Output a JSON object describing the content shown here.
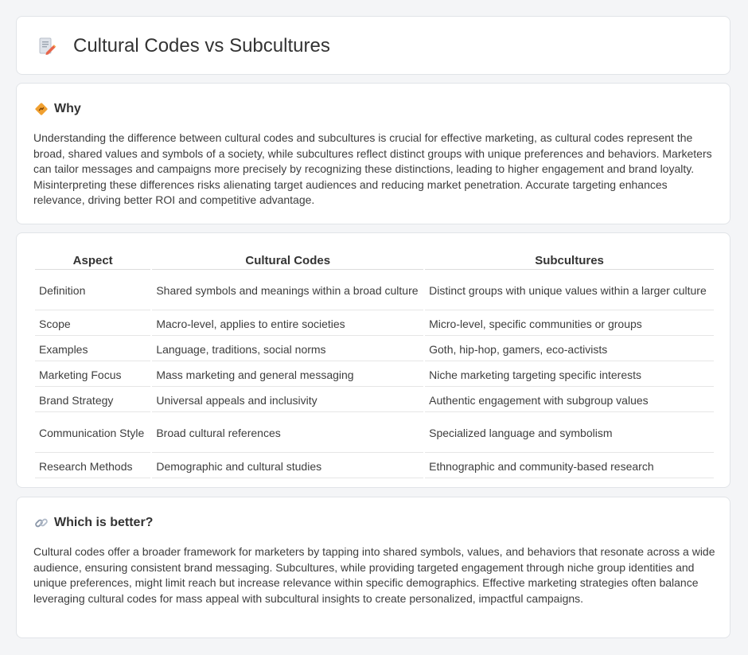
{
  "header": {
    "title": "Cultural Codes vs Subcultures",
    "icon": "document-pencil-icon"
  },
  "why": {
    "heading": "Why",
    "icon": "diamond-sign-icon",
    "body": "Understanding the difference between cultural codes and subcultures is crucial for effective marketing, as cultural codes represent the broad, shared values and symbols of a society, while subcultures reflect distinct groups with unique preferences and behaviors. Marketers can tailor messages and campaigns more precisely by recognizing these distinctions, leading to higher engagement and brand loyalty. Misinterpreting these differences risks alienating target audiences and reducing market penetration. Accurate targeting enhances relevance, driving better ROI and competitive advantage."
  },
  "table": {
    "headers": [
      "Aspect",
      "Cultural Codes",
      "Subcultures"
    ],
    "rows": [
      [
        "Definition",
        "Shared symbols and meanings within a broad culture",
        "Distinct groups with unique values within a larger culture"
      ],
      [
        "Scope",
        "Macro-level, applies to entire societies",
        "Micro-level, specific communities or groups"
      ],
      [
        "Examples",
        "Language, traditions, social norms",
        "Goth, hip-hop, gamers, eco-activists"
      ],
      [
        "Marketing Focus",
        "Mass marketing and general messaging",
        "Niche marketing targeting specific interests"
      ],
      [
        "Brand Strategy",
        "Universal appeals and inclusivity",
        "Authentic engagement with subgroup values"
      ],
      [
        "Communication Style",
        "Broad cultural references",
        "Specialized language and symbolism"
      ],
      [
        "Research Methods",
        "Demographic and cultural studies",
        "Ethnographic and community-based research"
      ]
    ]
  },
  "better": {
    "heading": "Which is better?",
    "icon": "link-icon",
    "body": "Cultural codes offer a broader framework for marketers by tapping into shared symbols, values, and behaviors that resonate across a wide audience, ensuring consistent brand messaging. Subcultures, while providing targeted engagement through niche group identities and unique preferences, might limit reach but increase relevance within specific demographics. Effective marketing strategies often balance leveraging cultural codes for mass appeal with subcultural insights to create personalized, impactful campaigns."
  },
  "colors": {
    "background": "#f4f5f7",
    "card": "#ffffff",
    "border": "#e1e4e8",
    "accent_orange": "#f0a030"
  }
}
